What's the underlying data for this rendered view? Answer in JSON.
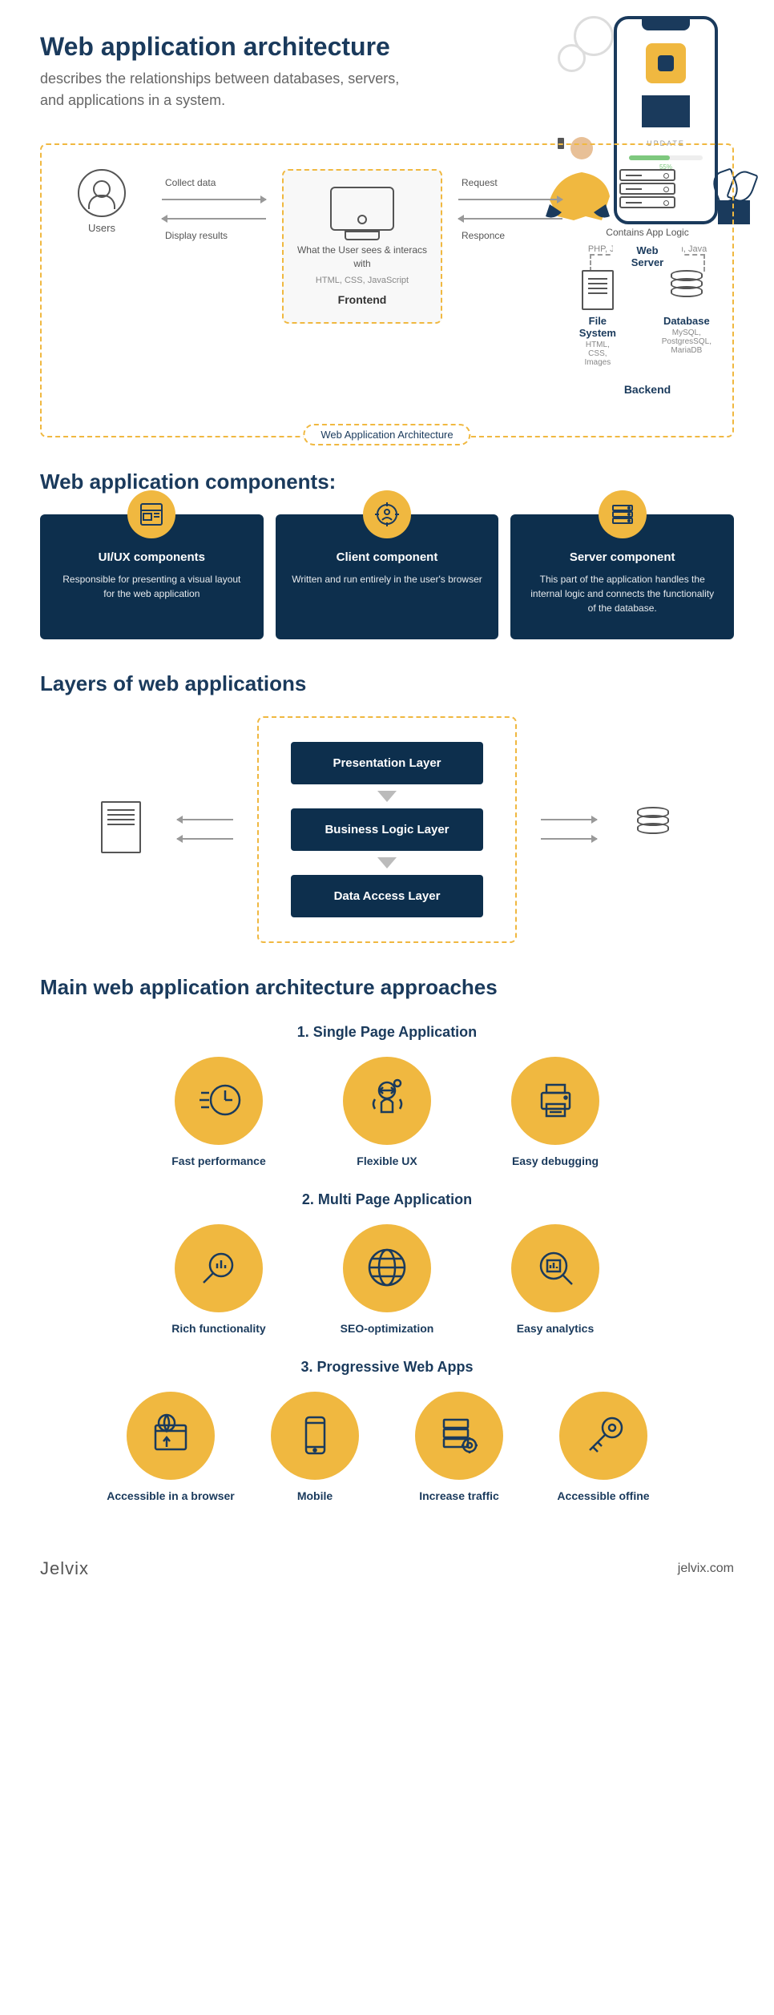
{
  "header": {
    "title": "Web application architecture",
    "subtitle": "describes the relationships between databases, servers, and applications in a system.",
    "phone_label": "UPDATE",
    "phone_percent": "55%"
  },
  "diagram": {
    "users_label": "Users",
    "arrow_collect": "Collect data",
    "arrow_display": "Display results",
    "frontend_desc": "What the User sees & interacs with",
    "frontend_tech": "HTML, CSS, JavaScript",
    "frontend_title": "Frontend",
    "arrow_request": "Request",
    "arrow_response": "Responce",
    "backend_desc": "Contains App Logic",
    "backend_tech": "PHP, JavaScript, Python, Java",
    "web_server": "Web Server",
    "file_title": "File System",
    "file_tech": "HTML, CSS, Images",
    "db_title": "Database",
    "db_tech": "MySQL, PostgresSQL, MariaDB",
    "backend_title": "Backend",
    "badge": "Web Application Architecture"
  },
  "components": {
    "heading": "Web application components:",
    "items": [
      {
        "title": "UI/UX components",
        "desc": "Responsible for presenting a visual layout for the web application"
      },
      {
        "title": "Client component",
        "desc": "Written and run entirely in the user's browser"
      },
      {
        "title": "Server component",
        "desc": "This part of the application handles the internal logic and connects the functionality of the database."
      }
    ]
  },
  "layers": {
    "heading": "Layers of web applications",
    "presentation": "Presentation Layer",
    "business": "Business Logic Layer",
    "data": "Data Access Layer"
  },
  "approaches": {
    "heading": "Main web application architecture approaches",
    "spa_title": "1. Single Page Application",
    "spa": [
      {
        "label": "Fast performance"
      },
      {
        "label": "Flexible UX"
      },
      {
        "label": "Easy debugging"
      }
    ],
    "mpa_title": "2. Multi Page Application",
    "mpa": [
      {
        "label": "Rich functionality"
      },
      {
        "label": "SEO-optimization"
      },
      {
        "label": "Easy analytics"
      }
    ],
    "pwa_title": "3. Progressive Web Apps",
    "pwa": [
      {
        "label": "Accessible in a browser"
      },
      {
        "label": "Mobile"
      },
      {
        "label": "Increase traffic"
      },
      {
        "label": "Accessible offine"
      }
    ]
  },
  "footer": {
    "logo": "Jelvix",
    "url": "jelvix.com"
  }
}
